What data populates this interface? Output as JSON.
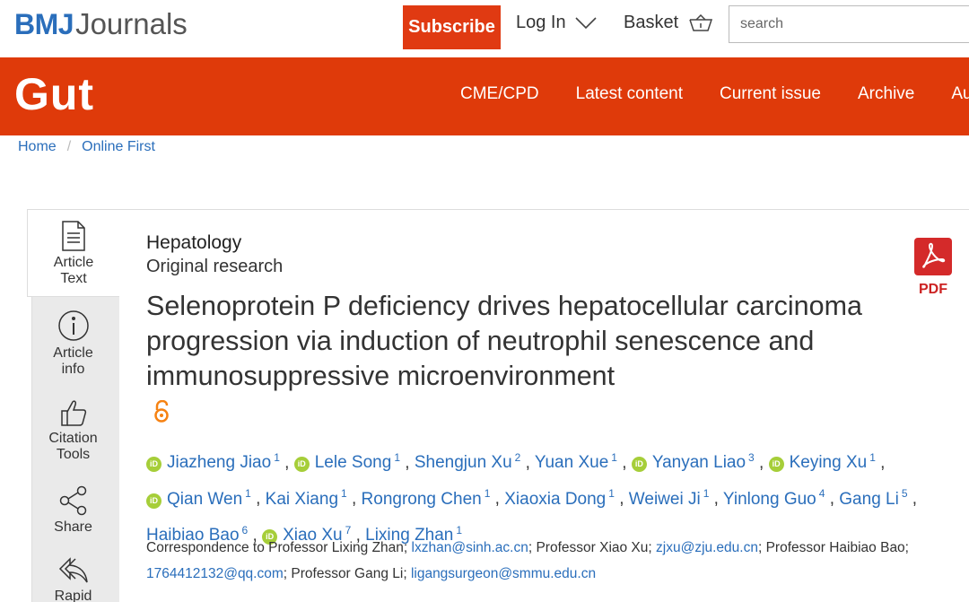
{
  "topbar": {
    "brand_bmj": "BMJ",
    "brand_journals": "Journals",
    "subscribe_label": "Subscribe",
    "login_label": "Log In",
    "basket_label": "Basket",
    "search_placeholder": "search"
  },
  "journal": {
    "name": "Gut",
    "nav": [
      "CME/CPD",
      "Latest content",
      "Current issue",
      "Archive",
      "Au"
    ]
  },
  "breadcrumb": {
    "home": "Home",
    "separator": "/",
    "current": "Online First"
  },
  "sidetools": [
    {
      "label": "Article Text",
      "icon": "document-icon"
    },
    {
      "label": "Article info",
      "icon": "info-icon"
    },
    {
      "label": "Citation Tools",
      "icon": "thumbs-up-icon"
    },
    {
      "label": "Share",
      "icon": "share-icon"
    },
    {
      "label": "Rapid",
      "icon": "rapid-response-icon"
    }
  ],
  "article": {
    "subject": "Hepatology",
    "type": "Original research",
    "title": "Selenoprotein P deficiency drives hepatocellular carcinoma progression via induction of neutrophil senescence and immunosuppressive microenvironment",
    "pdf_label": "PDF"
  },
  "authors": [
    {
      "name": "Jiazheng Jiao",
      "sup": "1",
      "orcid": true
    },
    {
      "name": "Lele Song",
      "sup": "1",
      "orcid": true
    },
    {
      "name": "Shengjun Xu",
      "sup": "2",
      "orcid": false
    },
    {
      "name": "Yuan Xue",
      "sup": "1",
      "orcid": false
    },
    {
      "name": "Yanyan Liao",
      "sup": "3",
      "orcid": true
    },
    {
      "name": "Keying Xu",
      "sup": "1",
      "orcid": true
    },
    {
      "name": "Qian Wen",
      "sup": "1",
      "orcid": true
    },
    {
      "name": "Kai Xiang",
      "sup": "1",
      "orcid": false
    },
    {
      "name": "Rongrong Chen",
      "sup": "1",
      "orcid": false
    },
    {
      "name": "Xiaoxia Dong",
      "sup": "1",
      "orcid": false
    },
    {
      "name": "Weiwei Ji",
      "sup": "1",
      "orcid": false
    },
    {
      "name": "Yinlong Guo",
      "sup": "4",
      "orcid": false
    },
    {
      "name": "Gang Li",
      "sup": "5",
      "orcid": false
    },
    {
      "name": "Haibiao Bao",
      "sup": "6",
      "orcid": false
    },
    {
      "name": "Xiao Xu",
      "sup": "7",
      "orcid": true
    },
    {
      "name": "Lixing Zhan",
      "sup": "1",
      "orcid": false
    }
  ],
  "correspondence": {
    "p1": "Correspondence to Professor Lixing Zhan; ",
    "e1": "lxzhan@sinh.ac.cn",
    "p2": "; Professor Xiao Xu; ",
    "e2": "zjxu@zju.edu.cn",
    "p3": "; Professor Haibiao Bao; ",
    "e3": "1764412132@qq.com",
    "p4": "; Professor Gang Li; ",
    "e4": "ligangsurgeon@smmu.edu.cn"
  },
  "colors": {
    "brand_blue": "#2a6ebb",
    "gut_red": "#df3a0a",
    "subscribe_red": "#e03a12",
    "orcid_green": "#a6ce39",
    "open_access_orange": "#f68212",
    "pdf_red": "#cc2222"
  }
}
